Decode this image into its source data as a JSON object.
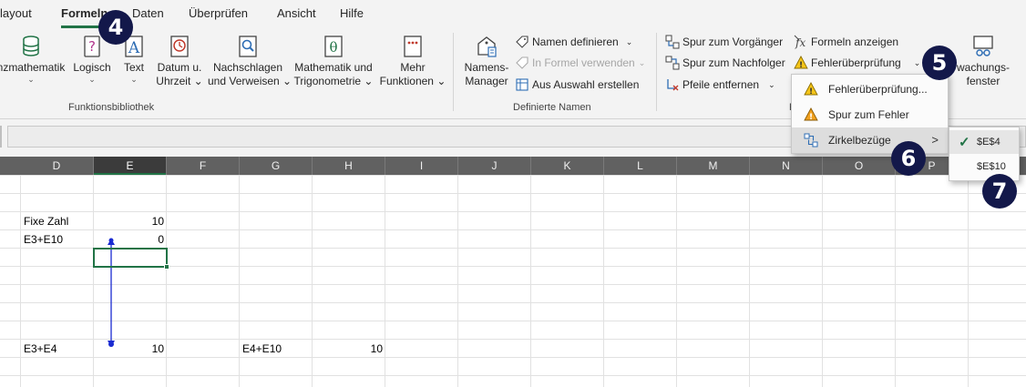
{
  "menu": {
    "tabs": [
      "layout",
      "Formeln",
      "Daten",
      "Überprüfen",
      "Ansicht",
      "Hilfe"
    ],
    "active": "Formeln"
  },
  "ribbon": {
    "function_library": {
      "buttons": [
        {
          "line1": "nzmathematik",
          "line2": "⌄"
        },
        {
          "line1": "Logisch",
          "line2": "⌄"
        },
        {
          "line1": "Text",
          "line2": "⌄"
        },
        {
          "line1": "Datum u.",
          "line2": "Uhrzeit ⌄"
        },
        {
          "line1": "Nachschlagen",
          "line2": "und Verweisen ⌄"
        },
        {
          "line1": "Mathematik und",
          "line2": "Trigonometrie ⌄"
        },
        {
          "line1": "Mehr",
          "line2": "Funktionen ⌄"
        }
      ],
      "label": "Funktionsbibliothek"
    },
    "defined_names": {
      "manager_line1": "Namens-",
      "manager_line2": "Manager",
      "define_name": "Namen definieren",
      "use_in_formula": "In Formel verwenden",
      "create_from_selection": "Aus Auswahl erstellen",
      "label": "Definierte Namen"
    },
    "formula_auditing": {
      "trace_precedents": "Spur zum Vorgänger",
      "trace_dependents": "Spur zum Nachfolger",
      "remove_arrows": "Pfeile entfernen",
      "show_formulas": "Formeln anzeigen",
      "error_checking": "Fehlerüberprüfung",
      "label_partial": "F",
      "watch_line1": "wachungs-",
      "watch_line2": "fenster"
    }
  },
  "columns": [
    "D",
    "E",
    "F",
    "G",
    "H",
    "I",
    "J",
    "K",
    "L",
    "M",
    "N",
    "O",
    "P"
  ],
  "selected_column": "E",
  "cells": {
    "d4": "Fixe Zahl",
    "e4": "10",
    "d5": "E3+E10",
    "e5": "0",
    "d10": "E3+E4",
    "e10": "10",
    "g10": "E4+E10",
    "h10": "10"
  },
  "dropdown": {
    "items": [
      {
        "label": "Fehlerüberprüfung..."
      },
      {
        "label": "Spur zum Fehler"
      },
      {
        "label": "Zirkelbezüge",
        "arrow": ">"
      }
    ]
  },
  "submenu": {
    "items": [
      {
        "label": "$E$4",
        "checked": true
      },
      {
        "label": "$E$10",
        "checked": false
      }
    ]
  },
  "badges": [
    "4",
    "5",
    "6",
    "7"
  ],
  "colors": {
    "accent": "#217346",
    "badge": "#13184a",
    "arrow": "#1a2bd1",
    "header": "#616161"
  }
}
